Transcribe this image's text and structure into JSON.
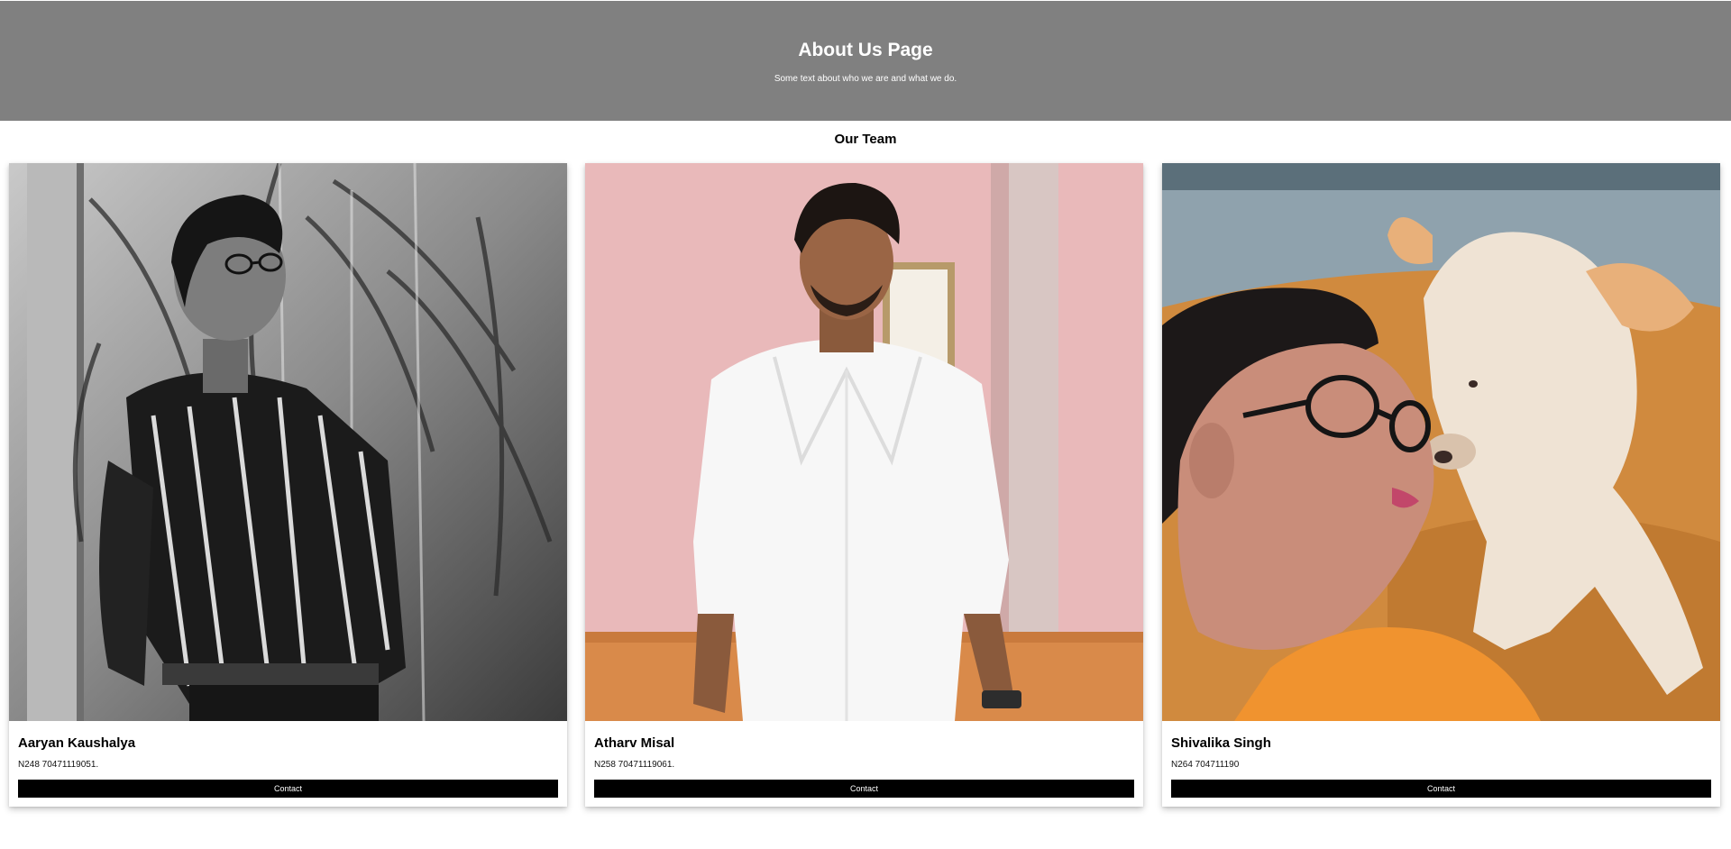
{
  "header": {
    "title": "About Us Page",
    "subtitle": "Some text about who we are and what we do."
  },
  "team": {
    "title": "Our Team",
    "members": [
      {
        "name": "Aaryan Kaushalya",
        "phone": "N248 70471119051.",
        "contact_label": "Contact",
        "photo_icon": "person-photo"
      },
      {
        "name": "Atharv Misal",
        "phone": "N258 70471119061.",
        "contact_label": "Contact",
        "photo_icon": "person-photo"
      },
      {
        "name": "Shivalika Singh",
        "phone": "N264 704711190",
        "contact_label": "Contact",
        "photo_icon": "person-with-dog-photo"
      }
    ]
  },
  "colors": {
    "header_bg": "#808080",
    "button_bg": "#000000",
    "button_text": "#ffffff"
  }
}
